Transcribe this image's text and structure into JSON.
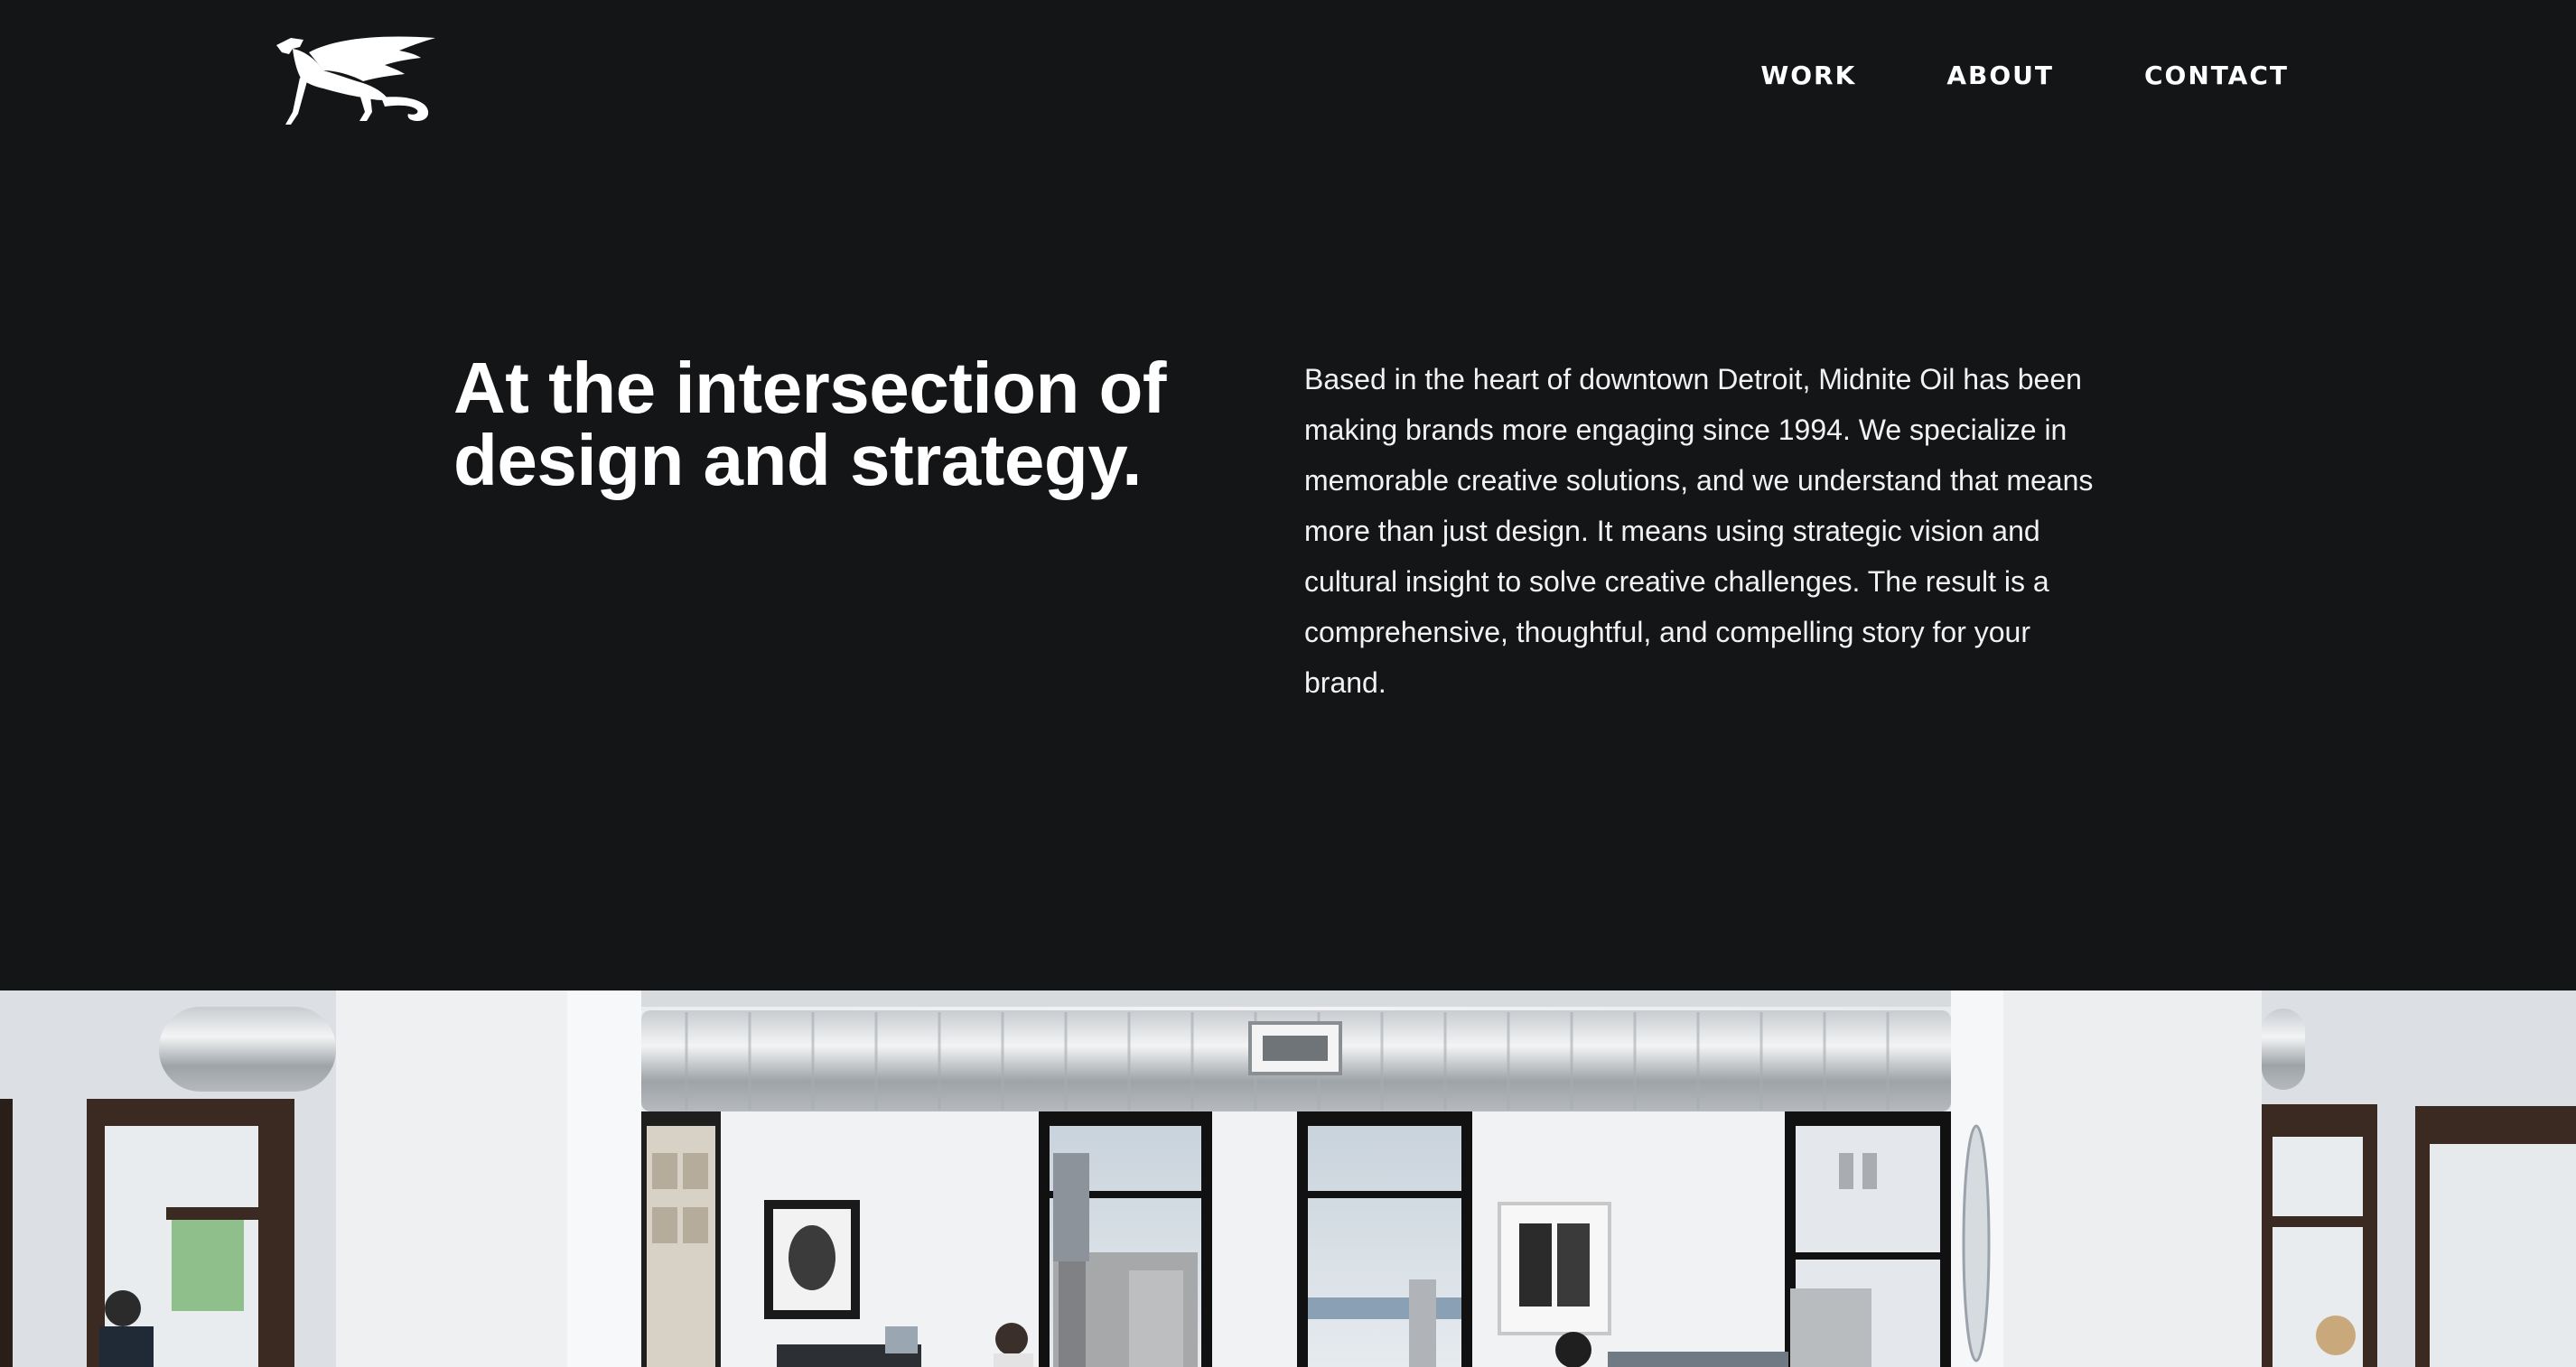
{
  "header": {
    "logo_icon": "griffin-logo-icon",
    "nav": [
      {
        "label": "WORK"
      },
      {
        "label": "ABOUT"
      },
      {
        "label": "CONTACT"
      }
    ]
  },
  "hero": {
    "headline": "At the intersection of design and strategy.",
    "intro": "Based in the heart of downtown Detroit, Midnite Oil has been making brands more engaging since 1994. We specialize in memorable creative solutions, and we understand that means more than just design. It means using strategic vision and cultural insight to solve creative challenges. The result is a comprehensive, thoughtful, and compelling story for your brand."
  },
  "photo": {
    "subject": "office-interior-photo"
  },
  "colors": {
    "background": "#141517",
    "text": "#ffffff"
  }
}
